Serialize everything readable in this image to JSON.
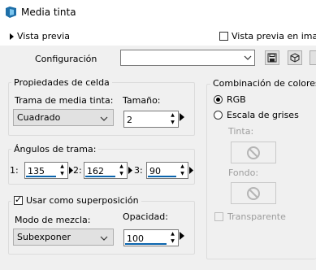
{
  "window": {
    "title": "Media tinta",
    "icon": "halftone-app-icon"
  },
  "preview": {
    "toggle_label": "Vista previa",
    "checkbox_label": "Vista previa en imag",
    "checked": false
  },
  "config": {
    "label": "Configuración",
    "value": ""
  },
  "cell_properties": {
    "title": "Propiedades de celda",
    "pattern_label": "Trama de media tinta:",
    "pattern_value": "Cuadrado",
    "size_label": "Tamaño:",
    "size_value": "2"
  },
  "screen_angles": {
    "title": "Ángulos de trama:",
    "angles": [
      {
        "label": "1:",
        "value": "135"
      },
      {
        "label": "2:",
        "value": "162"
      },
      {
        "label": "3:",
        "value": "90"
      }
    ]
  },
  "overlay": {
    "checkbox_label": "Usar como superposición",
    "checked": true,
    "blend_label": "Modo de mezcla:",
    "blend_value": "Subexponer",
    "opacity_label": "Opacidad:",
    "opacity_value": "100"
  },
  "color_combination": {
    "title": "Combinación de colores",
    "rgb_label": "RGB",
    "rgb_selected": true,
    "grayscale_label": "Escala de grises",
    "ink_label": "Tinta:",
    "background_label": "Fondo:",
    "transparent_label": "Transparente"
  },
  "colors": {
    "accent": "#0a64ad",
    "panel_bg": "#f0f0f0",
    "disabled_text": "#9d9d9d"
  }
}
